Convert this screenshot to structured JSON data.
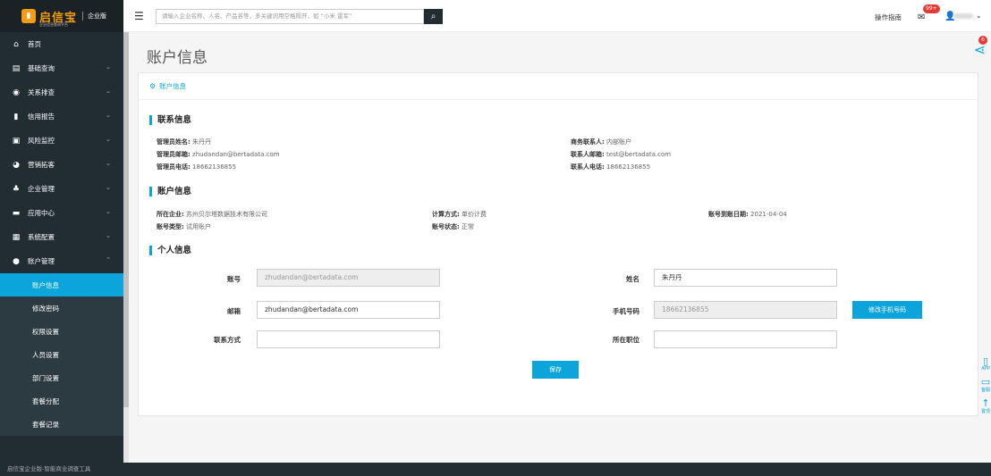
{
  "brand": {
    "name": "启信宝",
    "edition": "企业版",
    "tagline": "企业信息查询平台",
    "colors": {
      "accent": "#0ba5dc",
      "sidebar": "#222d32",
      "logo": "#f39c12"
    }
  },
  "topbar": {
    "search_placeholder": "请输入企业名称、人名、产品名等，多关键词用空格隔开，如 “小米 雷军”",
    "guide": "操作指南",
    "mail_badge": "99+"
  },
  "sidebar": {
    "items": [
      {
        "label": "首页",
        "icon": "home-icon"
      },
      {
        "label": "基础查询",
        "icon": "clipboard-icon"
      },
      {
        "label": "关系排查",
        "icon": "network-icon"
      },
      {
        "label": "信用报告",
        "icon": "book-icon"
      },
      {
        "label": "风险监控",
        "icon": "monitor-icon"
      },
      {
        "label": "营销拓客",
        "icon": "eye-icon"
      },
      {
        "label": "企业管理",
        "icon": "sitemap-icon"
      },
      {
        "label": "应用中心",
        "icon": "app-icon"
      },
      {
        "label": "系统配置",
        "icon": "grid-icon"
      },
      {
        "label": "账户管理",
        "icon": "user-circle-icon"
      }
    ],
    "submenu": [
      "账户信息",
      "修改密码",
      "权限设置",
      "人员设置",
      "部门设置",
      "套餐分配",
      "套餐记录"
    ]
  },
  "footer": "启信宝企业版-智能商业调查工具",
  "page": {
    "title": "账户信息",
    "share_badge": "6",
    "card_title": "账户信息"
  },
  "contact": {
    "title": "联系信息",
    "admin_name_label": "管理员姓名:",
    "admin_name": "朱丹丹",
    "admin_email_label": "管理员邮箱:",
    "admin_email": "zhudandan@bertadata.com",
    "admin_phone_label": "管理员电话:",
    "admin_phone": "18662136855",
    "biz_contact_label": "商务联系人:",
    "biz_contact": "内部账户",
    "contact_email_label": "联系人邮箱:",
    "contact_email": "test@bertadata.com",
    "contact_phone_label": "联系人电话:",
    "contact_phone": "18662136855"
  },
  "account": {
    "title": "账户信息",
    "company_label": "所在企业:",
    "company": "苏州贝尔塔数据技术有限公司",
    "type_label": "账号类型:",
    "type": "试用账户",
    "billing_label": "计算方式:",
    "billing": "单价计费",
    "status_label": "账号状态:",
    "status": "正常",
    "expiry_label": "账号到账日期:",
    "expiry": "2021-04-04"
  },
  "personal": {
    "title": "个人信息",
    "account_label": "账号",
    "account_value": "zhudandan@bertadata.com",
    "name_label": "姓名",
    "name_value": "朱丹丹",
    "email_label": "邮箱",
    "email_value": "zhudandan@bertadata.com",
    "mobile_label": "手机号码",
    "mobile_value": "18662136855",
    "change_mobile": "修改手机号码",
    "contact_label": "联系方式",
    "contact_value": "",
    "position_label": "所在职位",
    "position_value": "",
    "save": "保存"
  },
  "floatbar": [
    "APP",
    "客服",
    "置顶"
  ]
}
